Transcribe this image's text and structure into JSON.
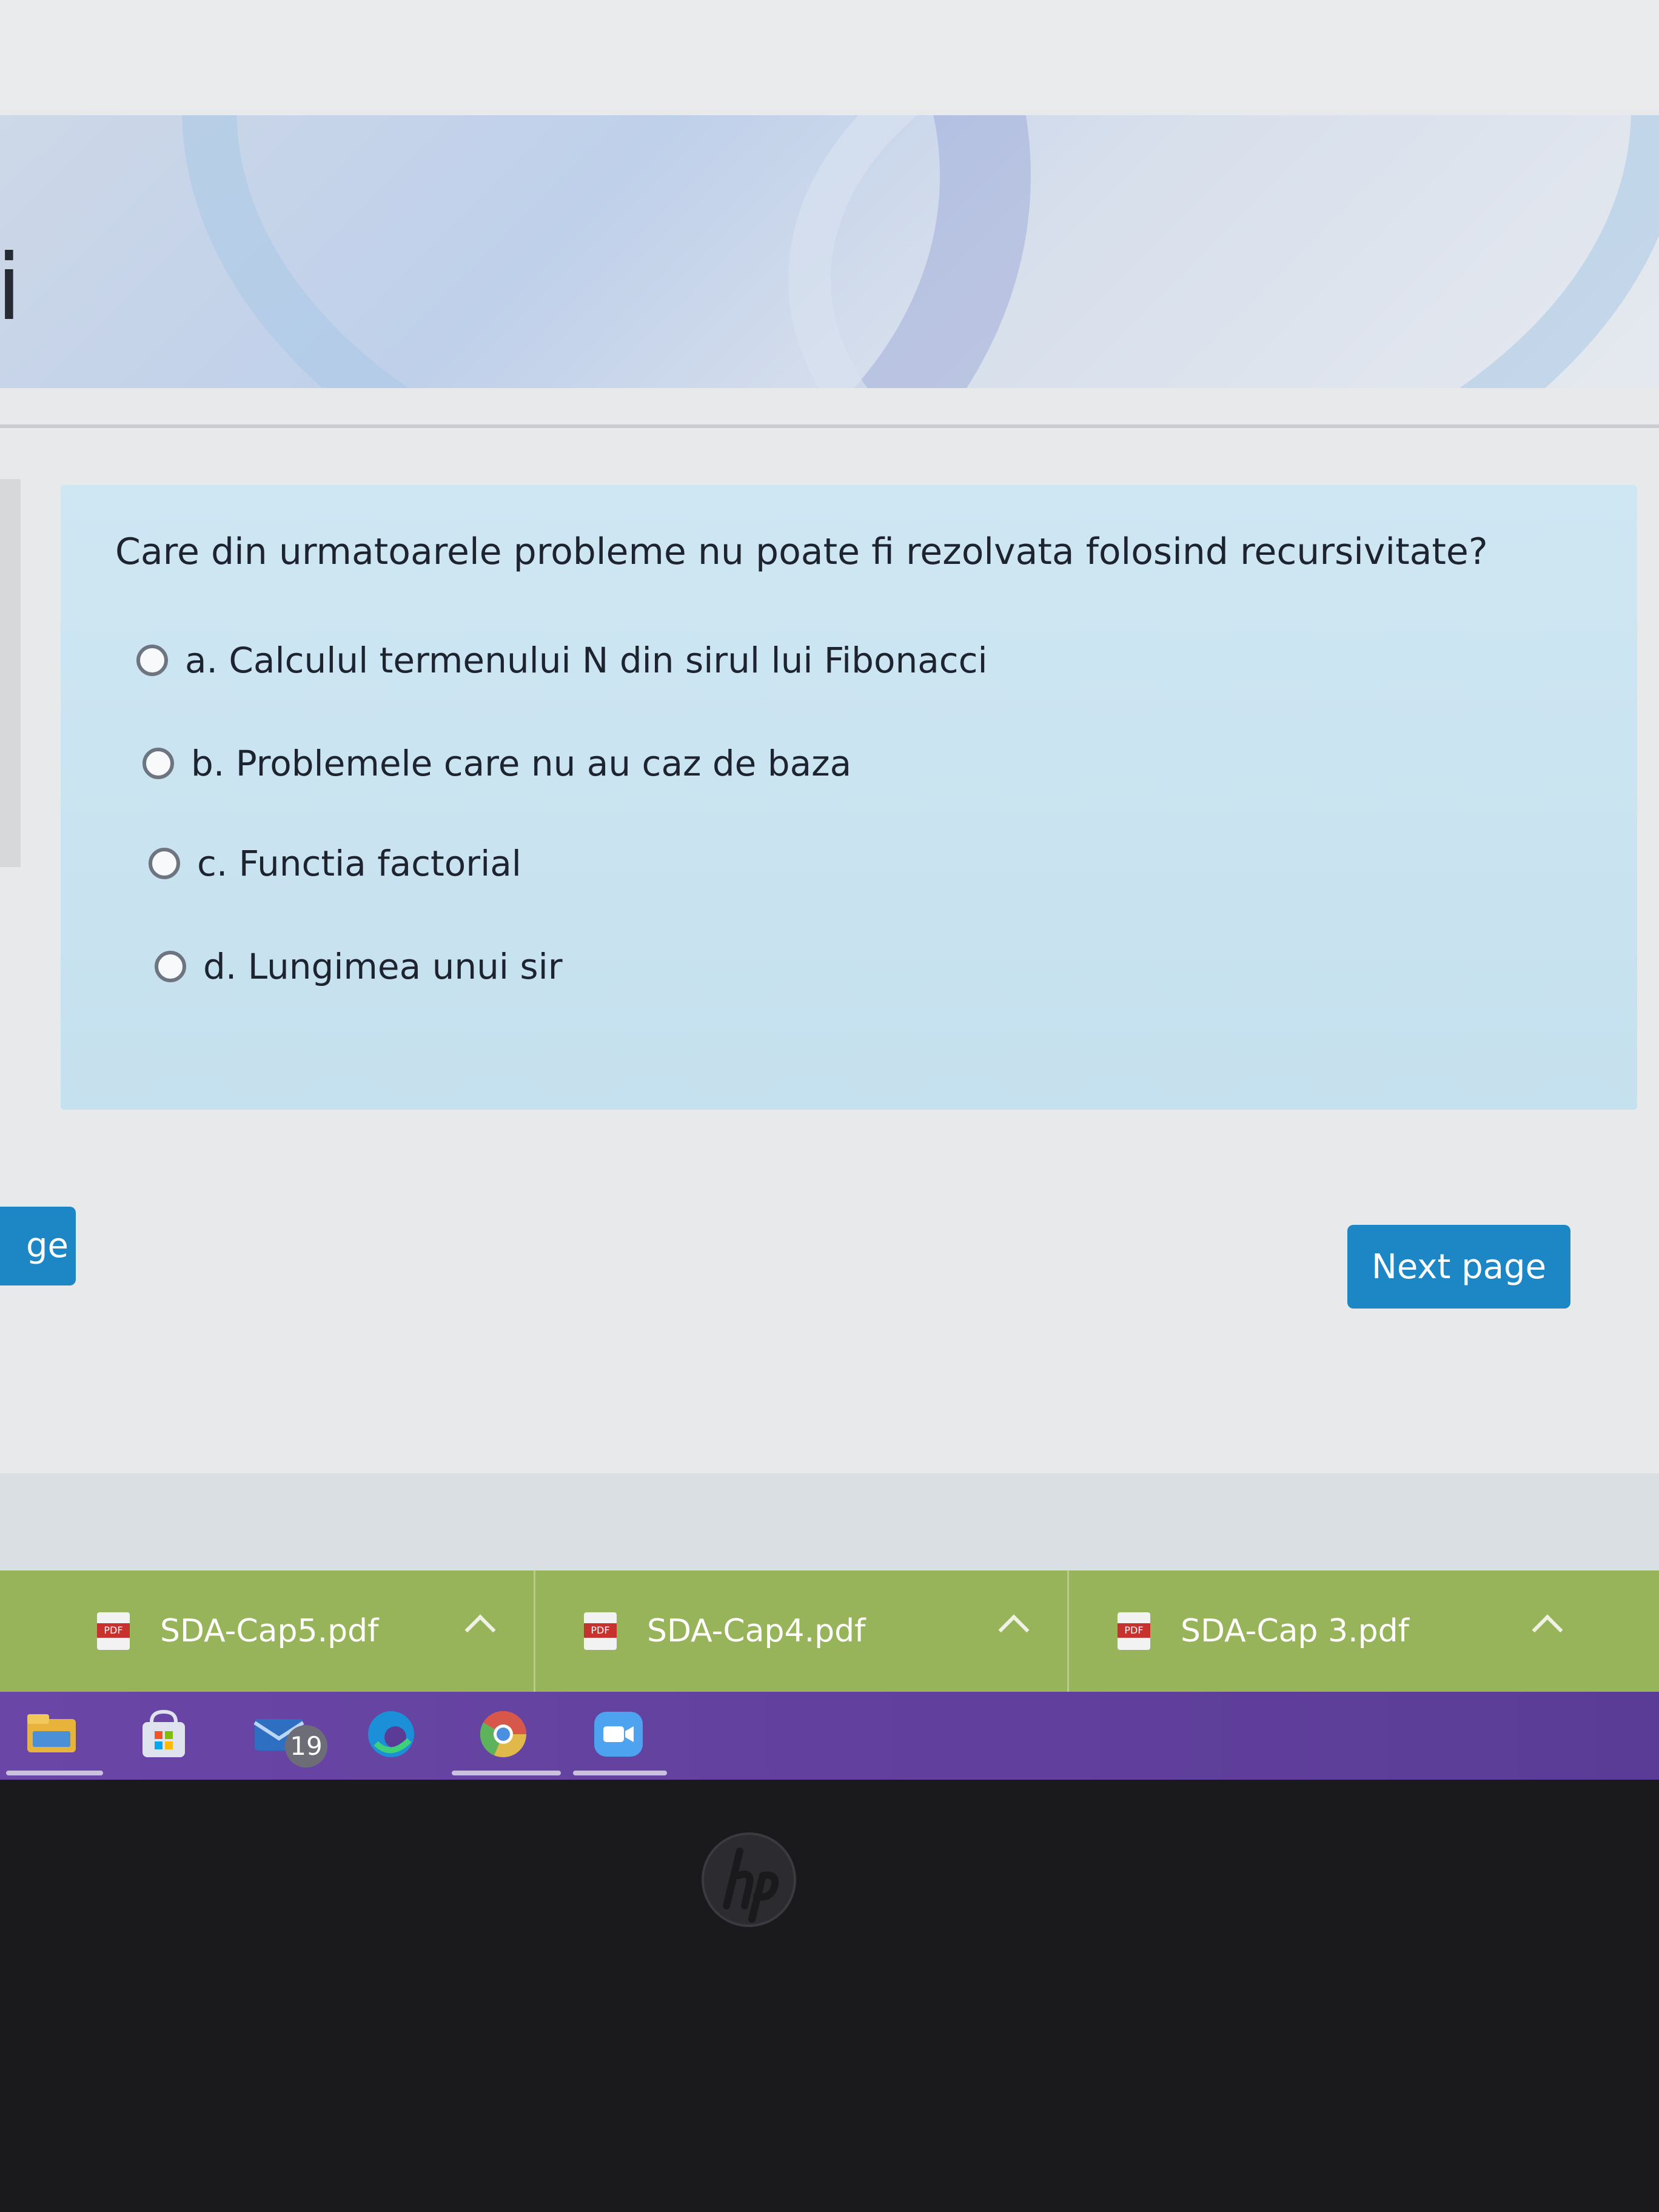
{
  "banner": {
    "title_fragment": "i"
  },
  "quiz": {
    "question": "Care din urmatoarele probleme nu poate fi rezolvata folosind recursivitate?",
    "answers": [
      {
        "label": "a. Calculul termenului N din sirul lui Fibonacci"
      },
      {
        "label": "b. Problemele care nu au caz de baza"
      },
      {
        "label": "c. Functia factorial"
      },
      {
        "label": "d. Lungimea unui sir"
      }
    ]
  },
  "navigation": {
    "previous_label_fragment": "ge",
    "next_label": "Next page"
  },
  "downloads": [
    {
      "icon_text": "PDF",
      "name": "SDA-Cap5.pdf"
    },
    {
      "icon_text": "PDF",
      "name": "SDA-Cap4.pdf"
    },
    {
      "icon_text": "PDF",
      "name": "SDA-Cap 3.pdf"
    }
  ],
  "taskbar": {
    "mail_badge": "19",
    "icons": [
      "file-explorer-icon",
      "microsoft-store-icon",
      "mail-icon",
      "edge-icon",
      "chrome-icon",
      "zoom-icon"
    ]
  },
  "colors": {
    "accent_button": "#1d87c6",
    "question_card": "#cfe7f3",
    "downloads_bar": "#98b45a",
    "taskbar": "#6a46a6"
  }
}
